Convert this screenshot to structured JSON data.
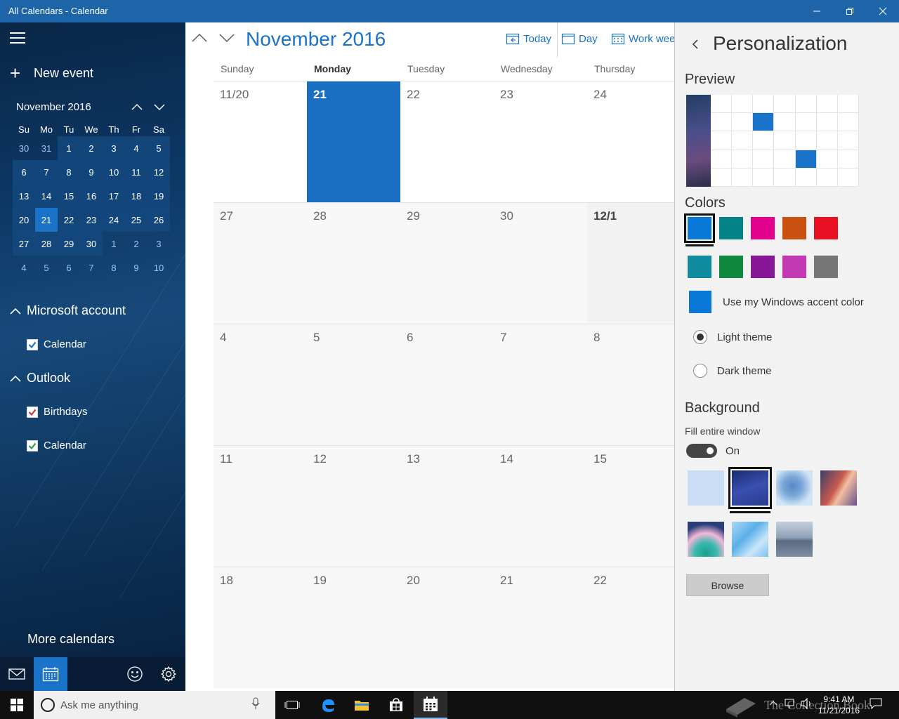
{
  "window": {
    "title": "All Calendars - Calendar"
  },
  "left": {
    "new_event": "New event",
    "mini_month": "November 2016",
    "dow": [
      "Su",
      "Mo",
      "Tu",
      "We",
      "Th",
      "Fr",
      "Sa"
    ],
    "weeks": [
      [
        "30",
        "31",
        "1",
        "2",
        "3",
        "4",
        "5"
      ],
      [
        "6",
        "7",
        "8",
        "9",
        "10",
        "11",
        "12"
      ],
      [
        "13",
        "14",
        "15",
        "16",
        "17",
        "18",
        "19"
      ],
      [
        "20",
        "21",
        "22",
        "23",
        "24",
        "25",
        "26"
      ],
      [
        "27",
        "28",
        "29",
        "30",
        "1",
        "2",
        "3"
      ],
      [
        "4",
        "5",
        "6",
        "7",
        "8",
        "9",
        "10"
      ]
    ],
    "accounts": [
      {
        "name": "Microsoft account",
        "calendars": [
          {
            "label": "Calendar",
            "color": "#1a73c9"
          }
        ]
      },
      {
        "name": "Outlook",
        "calendars": [
          {
            "label": "Birthdays",
            "color": "#d13438"
          },
          {
            "label": "Calendar",
            "color": "#2d9f48"
          }
        ]
      }
    ],
    "more_calendars": "More calendars"
  },
  "main": {
    "month_title": "November 2016",
    "views": {
      "today": "Today",
      "day": "Day",
      "workweek": "Work week"
    },
    "dow": [
      "Sunday",
      "Monday",
      "Tuesday",
      "Wednesday",
      "Thursday"
    ],
    "weeks": [
      [
        "11/20",
        "21",
        "22",
        "23",
        "24"
      ],
      [
        "27",
        "28",
        "29",
        "30",
        "12/1"
      ],
      [
        "4",
        "5",
        "6",
        "7",
        "8"
      ],
      [
        "11",
        "12",
        "13",
        "14",
        "15"
      ],
      [
        "18",
        "19",
        "20",
        "21",
        "22"
      ]
    ],
    "accent": "#1a6fc2"
  },
  "panel": {
    "title": "Personalization",
    "preview_heading": "Preview",
    "colors_heading": "Colors",
    "swatches": [
      "#0a78d7",
      "#038387",
      "#e3008c",
      "#ca5010",
      "#e81123",
      "#0f8b9d",
      "#10893e",
      "#881798",
      "#c239b3",
      "#767676"
    ],
    "accent_color": "#0a78d7",
    "use_accent_label": "Use my Windows accent color",
    "light_theme": "Light theme",
    "dark_theme": "Dark theme",
    "background_heading": "Background",
    "fill_window": "Fill entire window",
    "toggle_label": "On",
    "browse": "Browse"
  },
  "taskbar": {
    "search_placeholder": "Ask me anything",
    "time": "9:41 AM",
    "date": "11/21/2016",
    "watermark": "The Collection Book"
  }
}
